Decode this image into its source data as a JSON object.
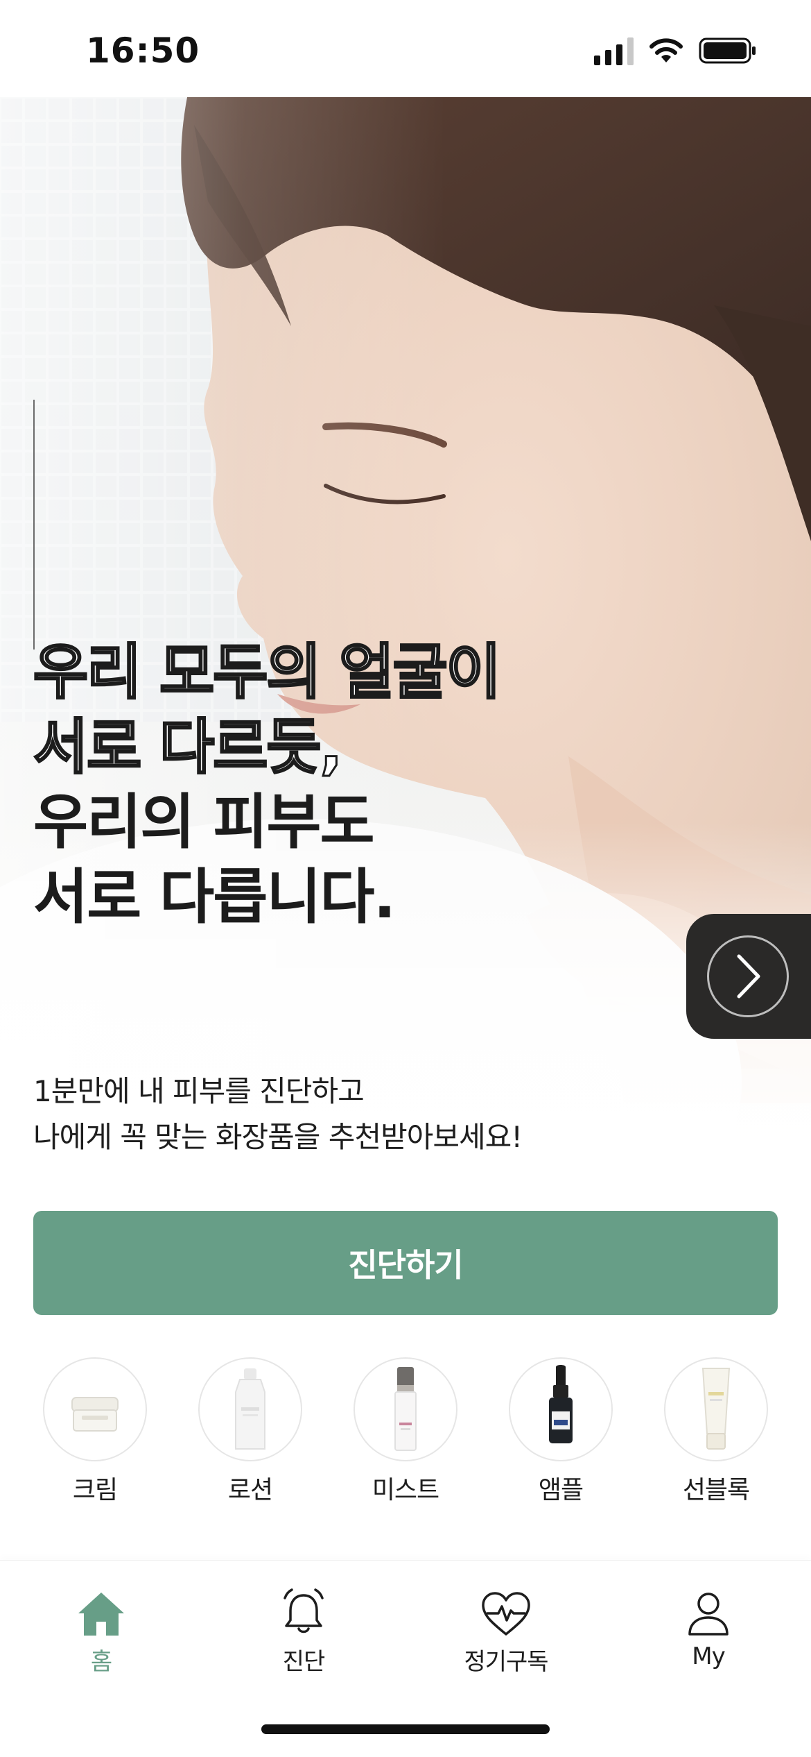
{
  "status_bar": {
    "time": "16:50"
  },
  "hero": {
    "headline_outline": [
      "우리 모두의 얼굴이",
      "서로 다르듯,"
    ],
    "headline_solid": [
      "우리의 피부도",
      "서로 다릅니다."
    ],
    "subtext": [
      "1분만에 내 피부를 진단하고",
      "나에게 꼭 맞는 화장품을 추천받아보세요!"
    ],
    "next_icon": "chevron-right-icon"
  },
  "cta": {
    "label": "진단하기",
    "color": "#679e87"
  },
  "categories": [
    {
      "label": "크림",
      "icon": "cream-jar-icon"
    },
    {
      "label": "로션",
      "icon": "lotion-bottle-icon"
    },
    {
      "label": "미스트",
      "icon": "mist-bottle-icon"
    },
    {
      "label": "앰플",
      "icon": "ampoule-dropper-icon"
    },
    {
      "label": "선블록",
      "icon": "sunblock-tube-icon"
    }
  ],
  "tab_bar": {
    "active_color": "#679e87",
    "items": [
      {
        "label": "홈",
        "icon": "home-icon",
        "active": true
      },
      {
        "label": "진단",
        "icon": "bell-icon",
        "active": false
      },
      {
        "label": "정기구독",
        "icon": "heart-pulse-icon",
        "active": false
      },
      {
        "label": "My",
        "icon": "user-icon",
        "active": false
      }
    ]
  }
}
